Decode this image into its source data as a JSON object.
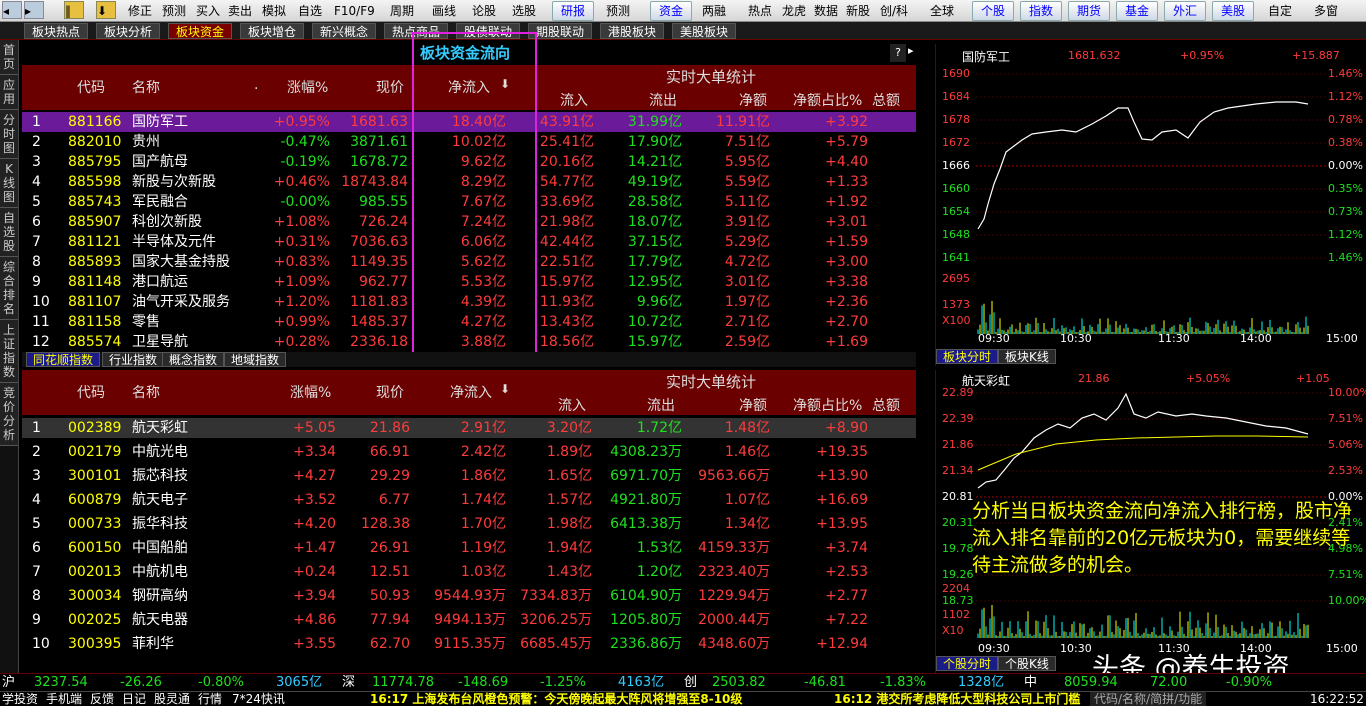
{
  "toolbar": {
    "items": [
      "修正",
      "预测",
      "买入",
      "卖出",
      "模拟",
      "自选",
      "F10/F9",
      "周期",
      "画线",
      "论股",
      "选股"
    ],
    "buttons": [
      "研报",
      "预测",
      "资金",
      "两融"
    ],
    "items2": [
      "热点",
      "龙虎",
      "数据",
      "新股",
      "创/科",
      "全球"
    ],
    "buttons2": [
      "个股",
      "指数",
      "期货",
      "基金",
      "外汇",
      "美股"
    ],
    "items3": [
      "自定",
      "多窗"
    ]
  },
  "nav": {
    "tabs": [
      "板块热点",
      "板块分析",
      "板块资金",
      "板块增仓",
      "新兴概念",
      "热点商品",
      "股债联动",
      "期股联动",
      "港股板块",
      "美股板块"
    ]
  },
  "sidebar": {
    "items": [
      "首页",
      "应用",
      "分时图",
      "K线图",
      "自选股",
      "综合排名",
      "上证指数",
      "竞价分析"
    ]
  },
  "highlight_label": "板块资金流向",
  "top": {
    "headers": {
      "code": "代码",
      "name": "名称",
      "dot": ".",
      "change": "涨幅%",
      "price": "现价",
      "net": "净流入",
      "bigstat": "实时大单统计",
      "inflow": "流入",
      "outflow": "流出",
      "netamt": "净额",
      "ratio": "净额占比%",
      "total": "总额"
    },
    "rows": [
      [
        "1",
        "881166",
        "国防军工",
        "+0.95%",
        "1681.63",
        "18.40亿",
        "43.91亿",
        "31.99亿",
        "11.91亿",
        "+3.92"
      ],
      [
        "2",
        "882010",
        "贵州",
        "-0.47%",
        "3871.61",
        "10.02亿",
        "25.41亿",
        "17.90亿",
        "7.51亿",
        "+5.79"
      ],
      [
        "3",
        "885795",
        "国产航母",
        "-0.19%",
        "1678.72",
        "9.62亿",
        "20.16亿",
        "14.21亿",
        "5.95亿",
        "+4.40"
      ],
      [
        "4",
        "885598",
        "新股与次新股",
        "+0.46%",
        "18743.84",
        "8.29亿",
        "54.77亿",
        "49.19亿",
        "5.59亿",
        "+1.33"
      ],
      [
        "5",
        "885743",
        "军民融合",
        "-0.00%",
        "985.55",
        "7.67亿",
        "33.69亿",
        "28.58亿",
        "5.11亿",
        "+1.92"
      ],
      [
        "6",
        "885907",
        "科创次新股",
        "+1.08%",
        "726.24",
        "7.24亿",
        "21.98亿",
        "18.07亿",
        "3.91亿",
        "+3.01"
      ],
      [
        "7",
        "881121",
        "半导体及元件",
        "+0.31%",
        "7036.63",
        "6.06亿",
        "42.44亿",
        "37.15亿",
        "5.29亿",
        "+1.59"
      ],
      [
        "8",
        "885893",
        "国家大基金持股",
        "+0.83%",
        "1149.35",
        "5.62亿",
        "22.51亿",
        "17.79亿",
        "4.72亿",
        "+3.00"
      ],
      [
        "9",
        "881148",
        "港口航运",
        "+1.09%",
        "962.77",
        "5.53亿",
        "15.97亿",
        "12.95亿",
        "3.01亿",
        "+3.38"
      ],
      [
        "10",
        "881107",
        "油气开采及服务",
        "+1.20%",
        "1181.83",
        "4.39亿",
        "11.93亿",
        "9.96亿",
        "1.97亿",
        "+2.36"
      ],
      [
        "11",
        "881158",
        "零售",
        "+0.99%",
        "1485.37",
        "4.27亿",
        "13.43亿",
        "10.72亿",
        "2.71亿",
        "+2.70"
      ],
      [
        "12",
        "885574",
        "卫星导航",
        "+0.28%",
        "2336.18",
        "3.88亿",
        "18.56亿",
        "15.97亿",
        "2.59亿",
        "+1.69"
      ]
    ]
  },
  "subtabs": [
    "同花顺指数",
    "行业指数",
    "概念指数",
    "地域指数"
  ],
  "bottom": {
    "headers": {
      "code": "代码",
      "name": "名称",
      "change": "涨幅%",
      "price": "现价",
      "net": "净流入",
      "bigstat": "实时大单统计",
      "inflow": "流入",
      "outflow": "流出",
      "netamt": "净额",
      "ratio": "净额占比%",
      "total": "总额"
    },
    "rows": [
      [
        "1",
        "002389",
        "航天彩虹",
        "+5.05",
        "21.86",
        "2.91亿",
        "3.20亿",
        "1.72亿",
        "1.48亿",
        "+8.90"
      ],
      [
        "2",
        "002179",
        "中航光电",
        "+3.34",
        "66.91",
        "2.42亿",
        "1.89亿",
        "4308.23万",
        "1.46亿",
        "+19.35"
      ],
      [
        "3",
        "300101",
        "振芯科技",
        "+4.27",
        "29.29",
        "1.86亿",
        "1.65亿",
        "6971.70万",
        "9563.66万",
        "+13.90"
      ],
      [
        "4",
        "600879",
        "航天电子",
        "+3.52",
        "6.77",
        "1.74亿",
        "1.57亿",
        "4921.80万",
        "1.07亿",
        "+16.69"
      ],
      [
        "5",
        "000733",
        "振华科技",
        "+4.20",
        "128.38",
        "1.70亿",
        "1.98亿",
        "6413.38万",
        "1.34亿",
        "+13.95"
      ],
      [
        "6",
        "600150",
        "中国船舶",
        "+1.47",
        "26.91",
        "1.19亿",
        "1.94亿",
        "1.53亿",
        "4159.33万",
        "+3.74"
      ],
      [
        "7",
        "002013",
        "中航机电",
        "+0.24",
        "12.51",
        "1.03亿",
        "1.43亿",
        "1.20亿",
        "2323.40万",
        "+2.53"
      ],
      [
        "8",
        "300034",
        "钢研高纳",
        "+3.94",
        "50.93",
        "9544.93万",
        "7334.83万",
        "6104.90万",
        "1229.94万",
        "+2.77"
      ],
      [
        "9",
        "002025",
        "航天电器",
        "+4.86",
        "77.94",
        "9494.13万",
        "3206.25万",
        "1205.80万",
        "2000.44万",
        "+7.22"
      ],
      [
        "10",
        "300395",
        "菲利华",
        "+3.55",
        "62.70",
        "9115.35万",
        "6685.45万",
        "2336.86万",
        "4348.60万",
        "+12.94"
      ]
    ]
  },
  "chart1": {
    "title": "国防军工",
    "price": "1681.632",
    "pct": "+0.95%",
    "chg": "+15.887",
    "yleft": [
      "1690",
      "1684",
      "1678",
      "1672",
      "1666",
      "1660",
      "1654",
      "1648",
      "1641"
    ],
    "yright": [
      "1.46%",
      "1.12%",
      "0.78%",
      "0.38%",
      "0.00%",
      "0.35%",
      "0.73%",
      "1.12%",
      "1.46%"
    ],
    "vol": [
      "2695",
      "1373"
    ],
    "volunit": "X100",
    "times": [
      "09:30",
      "10:30",
      "11:30",
      "14:00",
      "15:00"
    ],
    "tabs": [
      "板块分时",
      "板块K线"
    ]
  },
  "chart2": {
    "title": "航天彩虹",
    "price": "21.86",
    "pct": "+5.05%",
    "chg": "+1.05",
    "yleft": [
      "22.89",
      "22.39",
      "21.86",
      "21.34",
      "20.81",
      "20.31",
      "19.78",
      "19.26",
      "18.73"
    ],
    "yright": [
      "10.00%",
      "7.51%",
      "5.06%",
      "2.53%",
      "0.00%",
      "2.41%",
      "4.98%",
      "7.51%",
      "10.00%"
    ],
    "vol": [
      "2204",
      "1102"
    ],
    "volunit": "X10",
    "times": [
      "09:30",
      "10:30",
      "11:30",
      "14:00",
      "15:00"
    ],
    "tabs": [
      "个股分时",
      "个股K线"
    ]
  },
  "annotation": "分析当日板块资金流向净流入排行榜，股市净流入排名靠前的20亿元板块为0，需要继续等待主流做多的机会。",
  "watermark": "头条 @养生投资",
  "status": {
    "sh_label": "沪",
    "sh": "3237.54",
    "sh_chg": "-26.26",
    "sh_pct": "-0.80%",
    "sh_amt": "3065亿",
    "sz_label": "深",
    "sz": "11774.78",
    "sz_chg": "-148.69",
    "sz_pct": "-1.25%",
    "sz_amt": "4163亿",
    "cy_label": "创",
    "cy": "2503.82",
    "cy_chg": "-46.81",
    "cy_pct": "-1.83%",
    "cy_amt": "1328亿",
    "zh_label": "中",
    "zh": "8059.94",
    "zh_chg": "72.00",
    "zh_pct": "-0.90%"
  },
  "ticker": {
    "left": [
      "学投资",
      "手机端",
      "反馈",
      "日记",
      "股灵通",
      "行情",
      "7*24快讯"
    ],
    "news1": "16:17 上海发布台风橙色预警：今天傍晚起最大阵风将增强至8-10级",
    "news2": "16:12 港交所考虑降低大型科技公司上市门槛",
    "search": "代码/名称/简拼/功能",
    "time": "16:22:52"
  }
}
